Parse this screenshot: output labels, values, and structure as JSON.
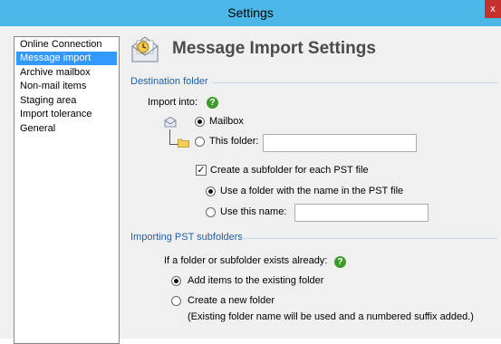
{
  "window": {
    "title": "Settings",
    "close_glyph": "x"
  },
  "nav": {
    "items": [
      {
        "label": "Online Connection",
        "selected": false
      },
      {
        "label": "Message import",
        "selected": true
      },
      {
        "label": "Archive mailbox",
        "selected": false
      },
      {
        "label": "Non-mail items",
        "selected": false
      },
      {
        "label": "Staging area",
        "selected": false
      },
      {
        "label": "Import tolerance",
        "selected": false
      },
      {
        "label": "General",
        "selected": false
      }
    ]
  },
  "header": {
    "title": "Message Import Settings",
    "icon": "mail-clock-icon"
  },
  "destination": {
    "section_title": "Destination folder",
    "import_into_label": "Import into:",
    "help_glyph": "?",
    "mailbox_label": "Mailbox",
    "this_folder_label": "This folder:",
    "this_folder_value": "",
    "create_subfolder_label": "Create a subfolder for each PST file",
    "use_pst_name_label": "Use a folder with the name in the PST file",
    "use_this_name_label": "Use this name:",
    "use_this_name_value": ""
  },
  "subfolders": {
    "section_title": "Importing PST subfolders",
    "exists_label": "If a folder or subfolder exists already:",
    "help_glyph": "?",
    "add_existing_label": "Add items to the existing folder",
    "create_new_label": "Create a new folder",
    "note": "(Existing folder name will be used and a numbered suffix added.)"
  },
  "colors": {
    "titlebar": "#4cb8e8",
    "accent": "#1c5fb0",
    "selection": "#3399ff",
    "help": "#3d9d2c"
  }
}
